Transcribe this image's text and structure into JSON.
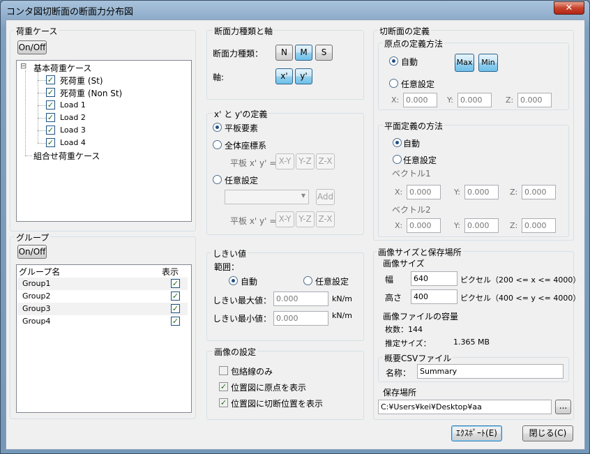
{
  "window": {
    "title": "コンタ図切断面の断面力分布図",
    "close": "✕"
  },
  "loadcase": {
    "title": "荷重ケース",
    "onoff": "On/Off",
    "expander": "⊟",
    "root": "基本荷重ケース",
    "items": [
      "死荷重 (St)",
      "死荷重 (Non St)",
      "Load 1",
      "Load 2",
      "Load 3",
      "Load 4"
    ],
    "checks": [
      "✓",
      "✓",
      "✓",
      "✓",
      "✓",
      "✓"
    ],
    "combo": "組合せ荷重ケース"
  },
  "group": {
    "title": "グループ",
    "onoff": "On/Off",
    "col_name": "グループ名",
    "col_show": "表示",
    "rows": [
      {
        "name": "Group1",
        "check": "✓"
      },
      {
        "name": "Group2",
        "check": "✓"
      },
      {
        "name": "Group3",
        "check": "✓"
      },
      {
        "name": "Group4",
        "check": "✓"
      }
    ]
  },
  "force": {
    "title": "断面力種類と軸",
    "type_label": "断面力種類：",
    "types": [
      "N",
      "M",
      "S"
    ],
    "axis_label": "軸:",
    "axes": [
      "x'",
      "y'"
    ]
  },
  "xy": {
    "title": "x' と y'の定義",
    "opt1": "平板要素",
    "opt2": "全体座標系",
    "plane_label": "平板 x' y' =",
    "planes": [
      "X-Y",
      "Y-Z",
      "Z-X"
    ],
    "opt3": "任意設定",
    "add": "Add",
    "plane_label2": "平板 x' y' ="
  },
  "threshold": {
    "title": "しきい値",
    "range": "範囲：",
    "auto": "自動",
    "manual": "任意設定",
    "max_label": "しきい最大値：",
    "max_val": "0.000",
    "min_label": "しきい最小値：",
    "min_val": "0.000",
    "unit1": "kN/m",
    "unit2": "kN/m"
  },
  "image_settings": {
    "title": "画像の設定",
    "opt1": "包絡線のみ",
    "opt2": "位置図に原点を表示",
    "opt3": "位置図に切断位置を表示",
    "check2": "✓",
    "check3": "✓"
  },
  "cut": {
    "title": "切断面の定義",
    "origin_title": "原点の定義方法",
    "auto": "自動",
    "max": "Max",
    "min": "Min",
    "manual": "任意設定",
    "x_label": "X:",
    "x": "0.000",
    "y_label": "Y:",
    "y": "0.000",
    "z_label": "Z:",
    "z": "0.000",
    "plane_title": "平面定義の方法",
    "p_auto": "自動",
    "p_manual": "任意設定",
    "v1_title": "ベクトル1",
    "v1": {
      "xl": "X:",
      "x": "0.000",
      "yl": "Y:",
      "y": "0.000",
      "zl": "Z:",
      "z": "0.000"
    },
    "v2_title": "ベクトル2",
    "v2": {
      "xl": "X:",
      "x": "0.000",
      "yl": "Y:",
      "y": "0.000",
      "zl": "Z:",
      "z": "0.000"
    }
  },
  "imgsize": {
    "title": "画像サイズと保存場所",
    "size_title": "画像サイズ",
    "w_label": "幅",
    "w_val": "640",
    "w_unit": "ピクセル（200 <= x <= 4000）",
    "h_label": "高さ",
    "h_val": "400",
    "h_unit": "ピクセル（400 <= y <= 4000）",
    "cap_title": "画像ファイルの容量",
    "count": "枚数：144",
    "est": "推定サイズ：",
    "est_val": "1.365 MB",
    "csv_title": "概要CSVファイル",
    "csv_label": "名称：",
    "csv_val": "Summary",
    "save_title": "保存場所",
    "path": "C:¥Users¥kei¥Desktop¥aa",
    "browse": "..."
  },
  "footer": {
    "export": "ｴｸｽﾎﾟｰﾄ(E)",
    "close": "閉じる(C)"
  },
  "colors": {
    "accent_on": "#98d1ef",
    "frame": "#7fa0c0",
    "check": "#1f6b1f"
  }
}
